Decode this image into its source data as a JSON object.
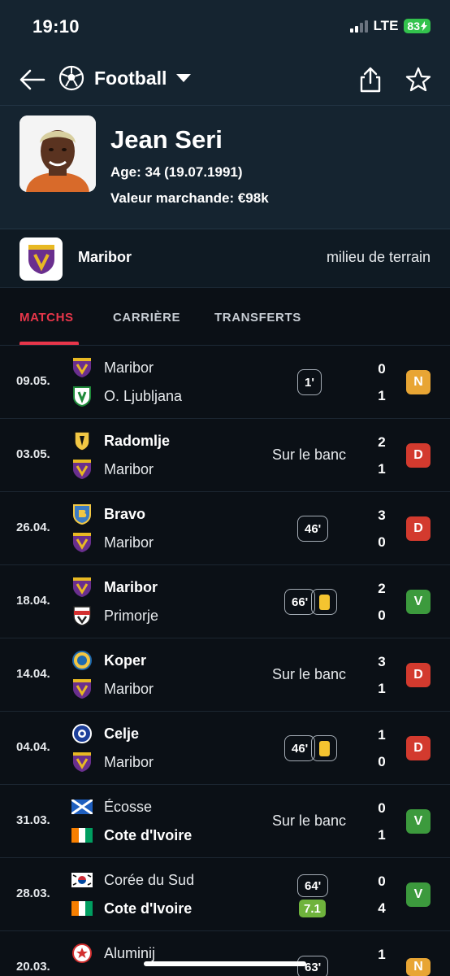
{
  "status": {
    "time": "19:10",
    "network": "LTE",
    "battery": "83"
  },
  "header": {
    "sport": "Football"
  },
  "player": {
    "name": "Jean Seri",
    "age": "Age: 34 (19.07.1991)",
    "market_value": "Valeur marchande: €98k"
  },
  "team": {
    "name": "Maribor",
    "position": "milieu de terrain"
  },
  "tabs": [
    "MATCHS",
    "CARRIÈRE",
    "TRANSFERTS"
  ],
  "matches": [
    {
      "date": "09.05.",
      "home": "Maribor",
      "away": "O. Ljubljana",
      "minutes": "1'",
      "home_score": "0",
      "away_score": "1",
      "result": "N"
    },
    {
      "date": "03.05.",
      "home": "Radomlje",
      "away": "Maribor",
      "bench": "Sur le banc",
      "home_score": "2",
      "away_score": "1",
      "result": "D"
    },
    {
      "date": "26.04.",
      "home": "Bravo",
      "away": "Maribor",
      "minutes": "46'",
      "home_score": "3",
      "away_score": "0",
      "result": "D"
    },
    {
      "date": "18.04.",
      "home": "Maribor",
      "away": "Primorje",
      "minutes": "66'",
      "home_score": "2",
      "away_score": "0",
      "result": "V"
    },
    {
      "date": "14.04.",
      "home": "Koper",
      "away": "Maribor",
      "bench": "Sur le banc",
      "home_score": "3",
      "away_score": "1",
      "result": "D"
    },
    {
      "date": "04.04.",
      "home": "Celje",
      "away": "Maribor",
      "minutes": "46'",
      "home_score": "1",
      "away_score": "0",
      "result": "D"
    },
    {
      "date": "31.03.",
      "home": "Écosse",
      "away": "Cote d'Ivoire",
      "bench": "Sur le banc",
      "home_score": "0",
      "away_score": "1",
      "result": "V"
    },
    {
      "date": "28.03.",
      "home": "Corée du Sud",
      "away": "Cote d'Ivoire",
      "minutes": "64'",
      "rating": "7.1",
      "home_score": "0",
      "away_score": "4",
      "result": "V"
    },
    {
      "date": "20.03.",
      "home": "Aluminij",
      "away": "",
      "minutes": "63'",
      "home_score": "1",
      "away_score": "",
      "result": "N"
    }
  ],
  "colors": {
    "accent": "#e8364a",
    "draw": "#e8a534",
    "loss": "#d33a2e",
    "win": "#3c9a3d",
    "header_bg": "#152430"
  }
}
